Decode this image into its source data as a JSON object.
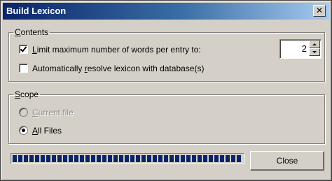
{
  "window": {
    "title": "Build Lexicon",
    "close_glyph": "✕"
  },
  "contents": {
    "legend_first": "C",
    "legend_rest": "ontents",
    "limit_checkbox": {
      "checked": true,
      "label_first": "L",
      "label_rest": "imit maximum number of words per entry to:"
    },
    "resolve_checkbox": {
      "checked": false,
      "label_before": "Automatically ",
      "label_accel": "r",
      "label_after": "esolve lexicon with database(s)"
    },
    "max_words_spinner": {
      "value": "2"
    }
  },
  "scope": {
    "legend_first": "S",
    "legend_rest": "cope",
    "current_file": {
      "label_first": "C",
      "label_rest": "urrent file",
      "enabled": false,
      "selected": false
    },
    "all_files": {
      "label_first": "A",
      "label_rest": "ll Files",
      "enabled": true,
      "selected": true
    }
  },
  "progress": {
    "fraction": 1.0
  },
  "buttons": {
    "close_label": "Close"
  },
  "colors": {
    "title_gradient_start": "#0a246a",
    "title_gradient_end": "#a6caf0",
    "dialog_face": "#d4d0c8",
    "progress_fill": "#0a246a"
  }
}
